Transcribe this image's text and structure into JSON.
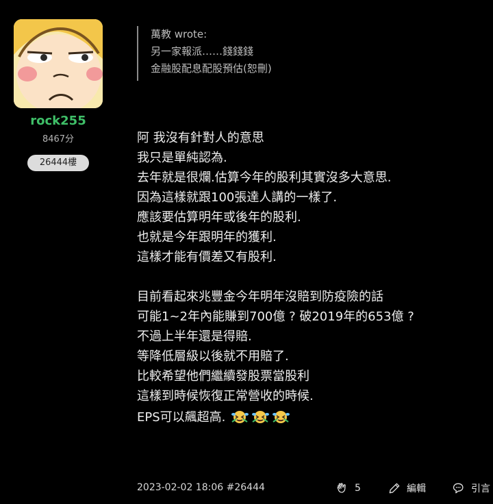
{
  "author": {
    "username": "rock255",
    "points": "8467分",
    "floor": "26444樓",
    "username_color": "#3fbf68"
  },
  "quote": {
    "header": "萬教 wrote:",
    "lines": [
      "另一家報派……錢錢錢",
      "金融股配息配股預估(恕刪)"
    ]
  },
  "post": {
    "lines_a": [
      "阿 我沒有針對人的意思",
      "我只是單純認為.",
      "去年就是很爛.估算今年的股利其實沒多大意思.",
      "因為這樣就跟100張達人講的一樣了.",
      "應該要估算明年或後年的股利.",
      "也就是今年跟明年的獲利.",
      "這樣才能有價差又有股利."
    ],
    "lines_b": [
      "目前看起來兆豐金今年明年沒賠到防疫險的話",
      "可能1~2年內能賺到700億 ? 破2019年的653億 ?",
      "不過上半年還是得賠.",
      "等降低層級以後就不用賠了.",
      "比較希望他們繼續發股票當股利",
      "這樣到時候恢復正常營收的時候."
    ],
    "last_line": "EPS可以飆超高.",
    "emojis": [
      "crying-laughing-emoji",
      "crying-laughing-emoji",
      "crying-laughing-emoji"
    ]
  },
  "meta": {
    "timestamp": "2023-02-02 18:06",
    "post_number": "#26444"
  },
  "actions": {
    "like_count": "5",
    "edit_label": "編輯",
    "quote_label": "引言"
  }
}
